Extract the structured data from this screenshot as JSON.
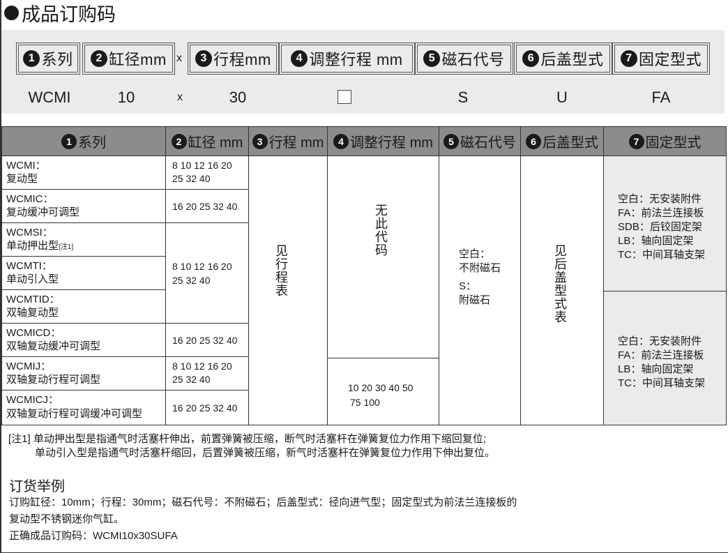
{
  "title": "成品订购码",
  "order_code": {
    "boxes": [
      {
        "num": "1",
        "label": "系列"
      },
      {
        "num": "2",
        "label": "缸径mm"
      },
      {
        "num": "3",
        "label": "行程mm"
      },
      {
        "num": "4",
        "label": "调整行程 mm"
      },
      {
        "num": "5",
        "label": "磁石代号"
      },
      {
        "num": "6",
        "label": "后盖型式"
      },
      {
        "num": "7",
        "label": "固定型式"
      }
    ],
    "times": "x",
    "example": {
      "series": "WCMI",
      "bore": "10",
      "times": "x",
      "stroke": "30",
      "magnet": "S",
      "cover": "U",
      "mount": "FA"
    }
  },
  "table": {
    "headers": [
      {
        "num": "1",
        "label": "系列"
      },
      {
        "num": "2",
        "label": "缸径 mm"
      },
      {
        "num": "3",
        "label": "行程 mm"
      },
      {
        "num": "4",
        "label": "调整行程 mm"
      },
      {
        "num": "5",
        "label": "磁石代号"
      },
      {
        "num": "6",
        "label": "后盖型式"
      },
      {
        "num": "7",
        "label": "固定型式"
      }
    ],
    "series": [
      {
        "code": "WCMI：",
        "desc": "复动型"
      },
      {
        "code": "WCMIC：",
        "desc": "复动缓冲可调型"
      },
      {
        "code": "WCMSI：",
        "desc": "单动押出型",
        "note": "[注1]"
      },
      {
        "code": "WCMTI：",
        "desc": "单动引入型"
      },
      {
        "code": "WCMTID：",
        "desc": "双轴复动型"
      },
      {
        "code": "WCMICD：",
        "desc": "双轴复动缓冲可调型"
      },
      {
        "code": "WCMIJ：",
        "desc": "双轴复动行程可调型"
      },
      {
        "code": "WCMICJ：",
        "desc": "双轴复动行程可调缓冲可调型"
      }
    ],
    "bores": {
      "a1": "8 10 12 16 20",
      "a2": "25 32 40",
      "b": "16 20 25 32 40"
    },
    "stroke_see": "见行程表",
    "adjust_none": "无此代码",
    "adjust_values1": "10 20 30 40 50",
    "adjust_values2": "75 100",
    "magnet": [
      "空白：",
      "不附磁石",
      "S：",
      "附磁石"
    ],
    "cover_see": "见后盖型式表",
    "mount_a": [
      "空白：无安装附件",
      "FA：前法兰连接板",
      "SDB：后铰固定架",
      "LB：轴向固定架",
      "TC：中间耳轴支架"
    ],
    "mount_b": [
      "空白：无安装附件",
      "FA：前法兰连接板",
      "LB：轴向固定架",
      "TC：中间耳轴支架"
    ]
  },
  "notes": {
    "line1": "[注1] 单动押出型是指通气时活塞杆伸出，前置弹簧被压缩，断气时活塞杆在弹簧复位力作用下缩回复位;",
    "line2": "单动引入型是指通气时活塞杆缩回，后置弹簧被压缩，新气时活塞杆在弹簧复位力作用下伸出复位。"
  },
  "order_example": {
    "title": "订货举例",
    "line1": "订购缸径：10mm；行程：30mm；磁石代号：不附磁石；后盖型式：径向进气型；固定型式为前法兰连接板的",
    "line2": "复动型不锈钢迷你气缸。",
    "line3": "正确成品订购码：WCMI10x30SUFA"
  }
}
